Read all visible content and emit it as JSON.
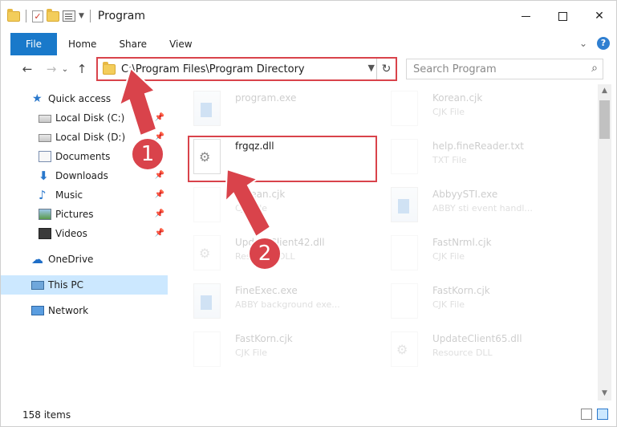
{
  "window": {
    "title": "Program",
    "controls": {
      "minimize": "—",
      "maximize": "□",
      "close": "✕"
    }
  },
  "ribbon": {
    "tabs": [
      "File",
      "Home",
      "Share",
      "View"
    ],
    "expand": "⌄",
    "help": "?"
  },
  "navigation": {
    "back": "←",
    "forward": "→",
    "recent": "⌄",
    "up": "↑",
    "address": "C:\\Program Files\\Program Directory",
    "refresh": "↻",
    "search_placeholder": "Search Program"
  },
  "sidebar": {
    "quick_access": "Quick access",
    "items": [
      {
        "label": "Local Disk (C:)",
        "icon": "drive-icon",
        "pinned": true
      },
      {
        "label": "Local Disk (D:)",
        "icon": "drive-icon",
        "pinned": true
      },
      {
        "label": "Documents",
        "icon": "documents-icon",
        "pinned": true
      },
      {
        "label": "Downloads",
        "icon": "downloads-icon",
        "pinned": true
      },
      {
        "label": "Music",
        "icon": "music-icon",
        "pinned": true
      },
      {
        "label": "Pictures",
        "icon": "pictures-icon",
        "pinned": true
      },
      {
        "label": "Videos",
        "icon": "videos-icon",
        "pinned": true
      }
    ],
    "onedrive": "OneDrive",
    "this_pc": "This PC",
    "network": "Network"
  },
  "files": {
    "left": [
      {
        "name": "program.exe",
        "type": "",
        "icon": "exe-icon"
      },
      {
        "name": "frgqz.dll",
        "type": "",
        "icon": "dll-icon"
      },
      {
        "name": "Korean.cjk",
        "type": "CJK File",
        "icon": "file-icon"
      },
      {
        "name": "UpdateClient42.dll",
        "type": "Resource DLL",
        "icon": "dll-icon"
      },
      {
        "name": "FineExec.exe",
        "type": "ABBY background exe...",
        "icon": "exe-icon"
      },
      {
        "name": "FastKorn.cjk",
        "type": "CJK File",
        "icon": "file-icon"
      }
    ],
    "right": [
      {
        "name": "Korean.cjk",
        "type": "CJK File",
        "icon": "file-icon"
      },
      {
        "name": "help.fineReader.txt",
        "type": "TXT File",
        "icon": "file-icon"
      },
      {
        "name": "AbbyySTI.exe",
        "type": "ABBY sti event handl...",
        "icon": "exe-icon"
      },
      {
        "name": "FastNrml.cjk",
        "type": "CJK File",
        "icon": "file-icon"
      },
      {
        "name": "FastKorn.cjk",
        "type": "CJK File",
        "icon": "file-icon"
      },
      {
        "name": "UpdateClient65.dll",
        "type": "Resource DLL",
        "icon": "dll-icon"
      }
    ]
  },
  "status": {
    "items": "158 items"
  },
  "annotations": {
    "step1": "1",
    "step2": "2",
    "color": "#d9434b"
  }
}
